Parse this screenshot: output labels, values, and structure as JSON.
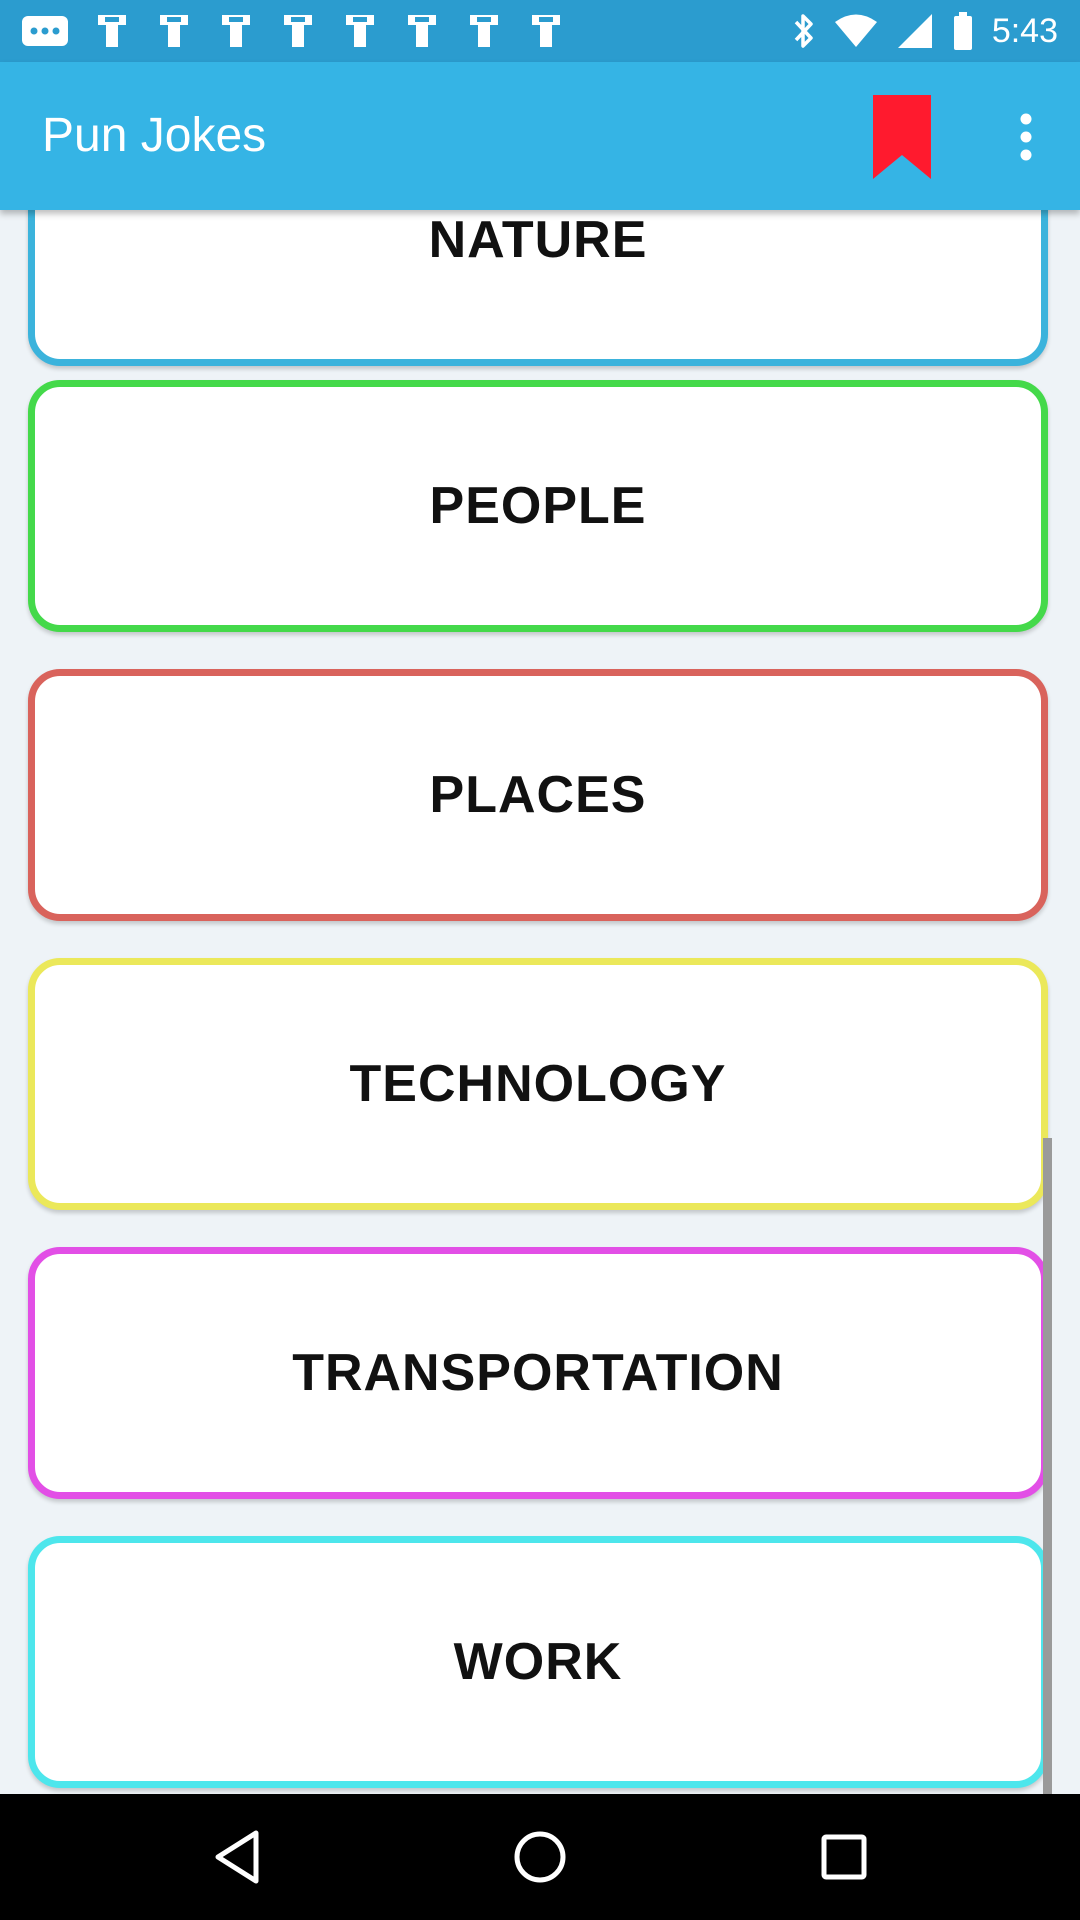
{
  "status_bar": {
    "time": "5:43",
    "notification_icons": [
      "messages-icon",
      "fan-icon",
      "fan-icon",
      "fan-icon",
      "fan-icon",
      "fan-icon",
      "fan-icon",
      "fan-icon",
      "fan-icon"
    ],
    "right_icons": [
      "bluetooth-icon",
      "wifi-icon",
      "signal-icon",
      "battery-icon"
    ]
  },
  "app_bar": {
    "title": "Pun Jokes",
    "bookmark_icon": "bookmark-icon",
    "bookmark_color": "#ff1a2e",
    "menu_icon": "more-vert-icon"
  },
  "categories": [
    {
      "label": "NATURE",
      "border_color": "#3bb3dc"
    },
    {
      "label": "PEOPLE",
      "border_color": "#44d94a"
    },
    {
      "label": "PLACES",
      "border_color": "#d9635c"
    },
    {
      "label": "TECHNOLOGY",
      "border_color": "#ebe85a"
    },
    {
      "label": "TRANSPORTATION",
      "border_color": "#e24fe6"
    },
    {
      "label": "WORK",
      "border_color": "#4de6ec"
    }
  ],
  "nav_bar": {
    "back_icon": "back-icon",
    "home_icon": "home-icon",
    "recents_icon": "recents-icon"
  },
  "colors": {
    "status_bar": "#2b9ccf",
    "app_bar": "#35b4e5"
  }
}
